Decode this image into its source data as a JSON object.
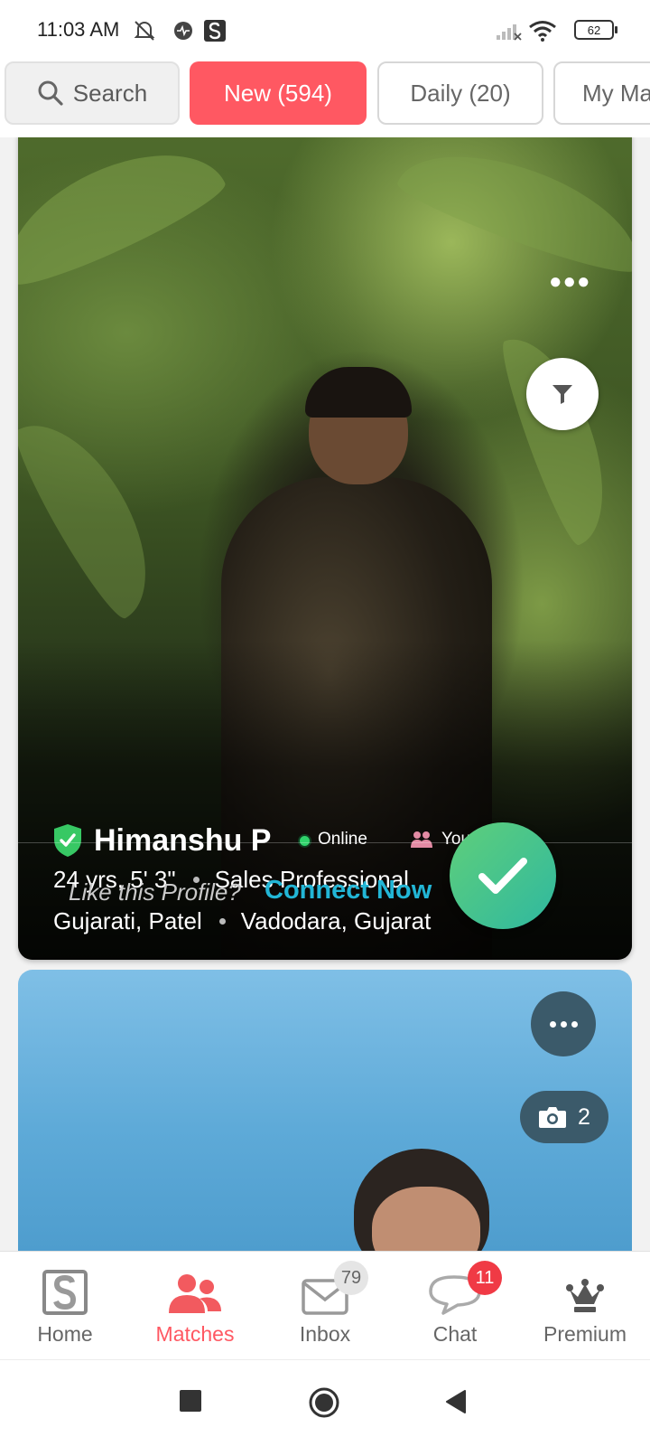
{
  "status_bar": {
    "time": "11:03 AM",
    "battery": "62",
    "icons": [
      "bell-off-icon",
      "activity-icon",
      "app-s-icon",
      "signal-icon",
      "wifi-icon",
      "battery-icon"
    ]
  },
  "tabs": [
    {
      "label": "Search",
      "icon": "search-icon",
      "active": false
    },
    {
      "label": "New (594)",
      "active": true
    },
    {
      "label": "Daily (20)",
      "active": false
    },
    {
      "label": "My Ma",
      "active": false
    }
  ],
  "profile_card": {
    "name": "Himanshu P",
    "verified_icon": "shield-check-icon",
    "online_label": "Online",
    "match_label": "You & Him",
    "age_height": "24 yrs, 5' 3\"",
    "profession": "Sales Professional",
    "community": "Gujarati, Patel",
    "location": "Vadodara, Gujarat",
    "like_prompt": "Like this Profile?",
    "connect_label": "Connect Now"
  },
  "second_card": {
    "photo_count": "2"
  },
  "bottom_nav": {
    "items": [
      {
        "label": "Home",
        "icon": "home-s-icon"
      },
      {
        "label": "Matches",
        "icon": "matches-icon",
        "active": true
      },
      {
        "label": "Inbox",
        "icon": "mail-icon",
        "badge": "79"
      },
      {
        "label": "Chat",
        "icon": "chat-icon",
        "badge": "11"
      },
      {
        "label": "Premium",
        "icon": "crown-icon"
      }
    ]
  },
  "colors": {
    "accent": "#ff5862",
    "connect_text": "#22b6d6",
    "online": "#2fd36b",
    "badge_red": "#f03a45"
  }
}
